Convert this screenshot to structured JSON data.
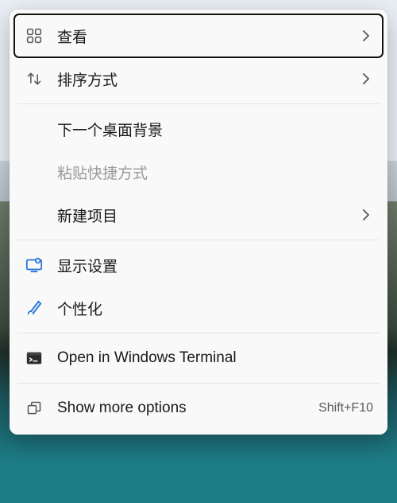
{
  "menu": {
    "items": [
      {
        "label": "查看"
      },
      {
        "label": "排序方式"
      },
      {
        "label": "下一个桌面背景"
      },
      {
        "label": "粘贴快捷方式"
      },
      {
        "label": "新建项目"
      },
      {
        "label": "显示设置"
      },
      {
        "label": "个性化"
      },
      {
        "label": "Open in Windows Terminal"
      },
      {
        "label": "Show more options",
        "shortcut": "Shift+F10"
      }
    ]
  }
}
